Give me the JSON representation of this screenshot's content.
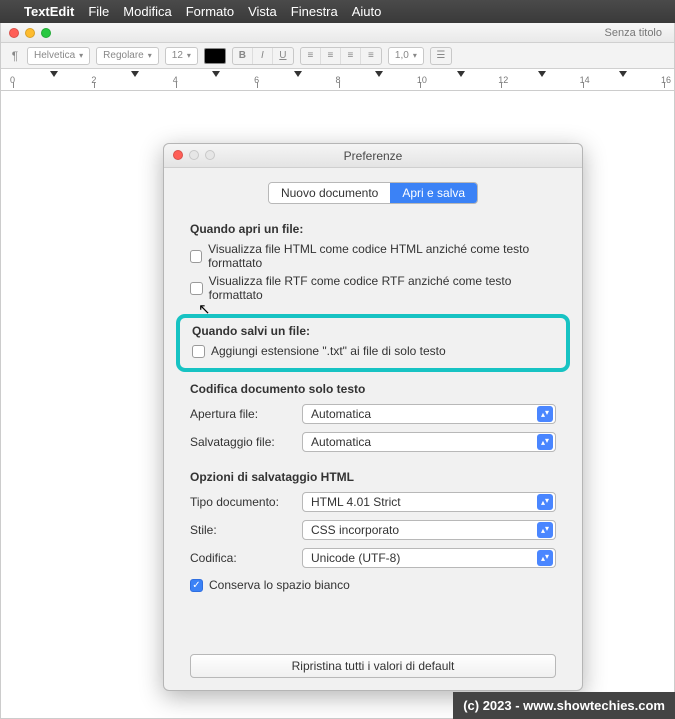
{
  "menubar": {
    "appname": "TextEdit",
    "items": [
      "File",
      "Modifica",
      "Formato",
      "Vista",
      "Finestra",
      "Aiuto"
    ]
  },
  "docwindow": {
    "title": "Senza titolo",
    "font_family": "Helvetica",
    "font_style": "Regolare",
    "font_size": "12",
    "line_spacing": "1,0"
  },
  "prefs": {
    "title": "Preferenze",
    "tabs": {
      "new_doc": "Nuovo documento",
      "open_save": "Apri e salva"
    },
    "open_section": {
      "heading": "Quando apri un file:",
      "opt_html": "Visualizza file HTML come codice HTML anziché come testo formattato",
      "opt_rtf": "Visualizza file RTF come codice RTF anziché come testo formattato"
    },
    "save_section": {
      "heading": "Quando salvi un file:",
      "opt_txt_ext": "Aggiungi estensione \".txt\" ai file di solo testo"
    },
    "encoding_section": {
      "heading": "Codifica documento solo testo",
      "open_label": "Apertura file:",
      "open_value": "Automatica",
      "save_label": "Salvataggio file:",
      "save_value": "Automatica"
    },
    "html_section": {
      "heading": "Opzioni di salvataggio HTML",
      "doctype_label": "Tipo documento:",
      "doctype_value": "HTML 4.01 Strict",
      "style_label": "Stile:",
      "style_value": "CSS incorporato",
      "enc_label": "Codifica:",
      "enc_value": "Unicode (UTF-8)",
      "preserve_ws": "Conserva lo spazio bianco"
    },
    "reset_button": "Ripristina tutti i valori di default"
  },
  "watermark": "(c) 2023 - www.showtechies.com",
  "ruler_numbers": [
    "0",
    "2",
    "4",
    "6",
    "8",
    "10",
    "12",
    "14",
    "16"
  ]
}
